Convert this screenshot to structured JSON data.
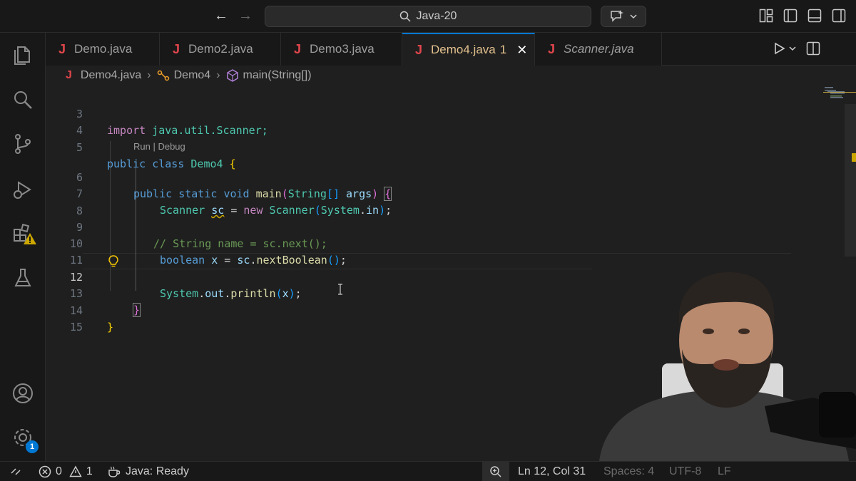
{
  "titlebar": {
    "search_text": "Java-20",
    "back_icon": "arrow-left-icon",
    "forward_icon": "arrow-right-icon"
  },
  "tabs": [
    {
      "label": "Demo.java",
      "active": false
    },
    {
      "label": "Demo2.java",
      "active": false
    },
    {
      "label": "Demo3.java",
      "active": false
    },
    {
      "label": "Demo4.java",
      "problems": "1",
      "active": true
    },
    {
      "label": "Scanner.java",
      "active": false,
      "preview": true
    }
  ],
  "tab_icon_letter": "J",
  "breadcrumb": {
    "file": "Demo4.java",
    "class": "Demo4",
    "method": "main(String[])"
  },
  "editor": {
    "codelens": "Run | Debug",
    "line_numbers": [
      "3",
      "4",
      "5",
      "6",
      "7",
      "8",
      "9",
      "10",
      "11",
      "12",
      "13",
      "14",
      "15"
    ],
    "current_line": "12",
    "lines": {
      "l3": {
        "kw": "import",
        "rest": " java.util.Scanner;"
      },
      "l5": {
        "kw1": "public",
        "kw2": "class",
        "name": "Demo4",
        "brace": "{"
      },
      "l6": {
        "kw1": "public",
        "kw2": "static",
        "kw3": "void",
        "fn": "main",
        "open": "(",
        "type": "String",
        "arr": "[]",
        "param": "args",
        "close": ")",
        "brace": "{"
      },
      "l7": {
        "type": "Scanner",
        "var": "sc",
        "eq": " = ",
        "kw": "new",
        "ctor": "Scanner",
        "open": "(",
        "sys": "System",
        "dot": ".",
        "field": "in",
        "close": ")",
        "semi": ";"
      },
      "l9": {
        "comment": "// String name = sc.next();"
      },
      "l10": {
        "kw": "boolean",
        "var": "x",
        "eq": " = ",
        "obj": "sc",
        "dot": ".",
        "fn": "nextBoolean",
        "parens": "()",
        "semi": ";"
      },
      "l12": {
        "sys": "System",
        "dot1": ".",
        "out": "out",
        "dot2": ".",
        "fn": "println",
        "open": "(",
        "arg": "x",
        "close": ")",
        "semi": ";"
      },
      "l13": {
        "brace": "}"
      },
      "l14": {
        "brace": "}"
      }
    }
  },
  "statusbar": {
    "errors": "0",
    "warnings": "1",
    "java_status": "Java: Ready",
    "cursor": "Ln 12, Col 31",
    "spaces": "Spaces: 4",
    "encoding": "UTF-8",
    "eol": "LF"
  },
  "activitybar": {
    "settings_badge": "1"
  },
  "colors": {
    "accent": "#0078d4",
    "java_icon": "#e0464c",
    "active_tab_text": "#e2c08d"
  }
}
